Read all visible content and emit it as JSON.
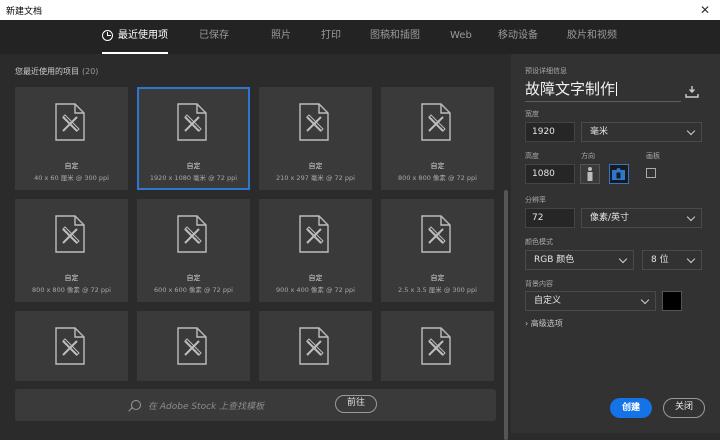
{
  "window": {
    "title": "新建文档",
    "close_glyph": "✕"
  },
  "nav": {
    "tabs": [
      {
        "label": "最近使用项",
        "active": true
      },
      {
        "label": "已保存"
      },
      {
        "label": "照片"
      },
      {
        "label": "打印"
      },
      {
        "label": "图稿和插图"
      },
      {
        "label": "Web"
      },
      {
        "label": "移动设备"
      },
      {
        "label": "胶片和视频"
      }
    ]
  },
  "recent": {
    "heading": "您最近使用的项目",
    "count": "(20)",
    "items": [
      {
        "name": "自定",
        "size": "40 x 60 厘米 @ 300 ppi"
      },
      {
        "name": "自定",
        "size": "1920 x 1080 毫米 @ 72 ppi",
        "selected": true
      },
      {
        "name": "自定",
        "size": "210 x 297 毫米 @ 72 ppi"
      },
      {
        "name": "自定",
        "size": "800 x 800 像素 @ 72 ppi"
      },
      {
        "name": "自定",
        "size": "800 x 800 像素 @ 72 ppi"
      },
      {
        "name": "自定",
        "size": "600 x 600 像素 @ 72 ppi"
      },
      {
        "name": "自定",
        "size": "900 x 400 像素 @ 72 ppi"
      },
      {
        "name": "自定",
        "size": "2.5 x 3.5 厘米 @ 300 ppi"
      },
      {
        "name": "",
        "size": ""
      },
      {
        "name": "",
        "size": ""
      },
      {
        "name": "",
        "size": ""
      },
      {
        "name": "",
        "size": ""
      }
    ]
  },
  "search": {
    "placeholder": "在 Adobe Stock 上查找模板",
    "go_label": "前往"
  },
  "preset": {
    "heading": "预设详细信息",
    "name": "故障文字制作",
    "width_label": "宽度",
    "width_value": "1920",
    "width_unit": "毫米",
    "height_label": "高度",
    "height_value": "1080",
    "orientation_label": "方向",
    "artboard_label": "画板",
    "resolution_label": "分辨率",
    "resolution_value": "72",
    "resolution_unit": "像素/英寸",
    "color_mode_label": "颜色模式",
    "color_mode": "RGB 颜色",
    "bit_depth": "8 位",
    "background_label": "背景内容",
    "background": "自定义",
    "background_color": "#000000",
    "advanced_label": "高级选项",
    "advanced_glyph": "›"
  },
  "actions": {
    "create": "创建",
    "close": "关闭"
  },
  "colors": {
    "accent": "#1473e6",
    "selection": "#2e77d0"
  }
}
